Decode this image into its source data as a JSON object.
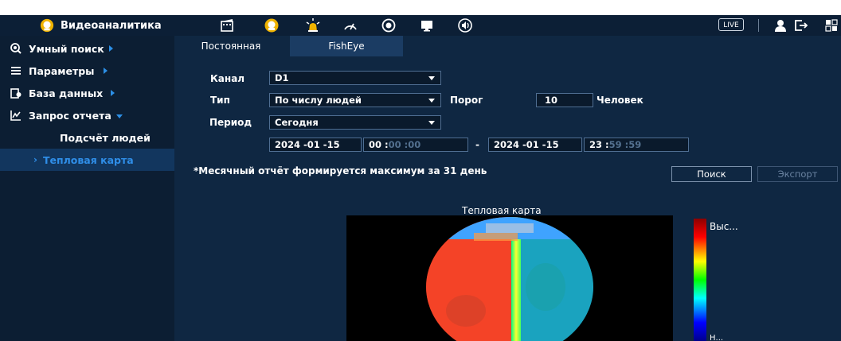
{
  "app": {
    "title": "Видеоаналитика"
  },
  "topbar": {
    "icons": [
      "film-icon",
      "face-icon",
      "alarm-icon",
      "gauge-icon",
      "record-icon",
      "monitor-icon",
      "speaker-icon"
    ],
    "live_label": "LIVE",
    "right_icons": [
      "user-icon",
      "logout-icon",
      "grid-icon"
    ]
  },
  "sidebar": {
    "items": [
      {
        "label": "Умный поиск",
        "icon": "smart-search-icon"
      },
      {
        "label": "Параметры",
        "icon": "list-icon"
      },
      {
        "label": "База данных",
        "icon": "database-icon"
      },
      {
        "label": "Запрос отчета",
        "icon": "report-icon"
      }
    ],
    "subitems": [
      {
        "label": "Подсчёт людей"
      },
      {
        "label": "Тепловая карта",
        "active": true,
        "arrow": "›"
      }
    ]
  },
  "tabs": [
    {
      "label": "Постоянная",
      "active": false
    },
    {
      "label": "FishEye",
      "active": true
    }
  ],
  "form": {
    "channel_label": "Канал",
    "channel_value": "D1",
    "type_label": "Тип",
    "type_value": "По числу людей",
    "threshold_label": "Порог",
    "threshold_value": "10",
    "threshold_unit": "Человек",
    "period_label": "Период",
    "period_value": "Сегодня",
    "start_date": "2024 -01 -15",
    "start_time_h": "00 :",
    "start_time_rest": "00 :00",
    "dash": "-",
    "end_date": "2024 -01 -15",
    "end_time_h": "23 :",
    "end_time_rest": "59 :59"
  },
  "note": "*Месячный отчёт формируется максимум за 31 день",
  "buttons": {
    "search": "Поиск",
    "export": "Экспорт"
  },
  "heatmap": {
    "title": "Тепловая карта",
    "legend_high": "Выс...",
    "legend_low": "Н...",
    "colors": [
      "#8b0000",
      "#ff0000",
      "#ffff00",
      "#00ff00",
      "#00ffff",
      "#0000ff",
      "#00008b"
    ]
  }
}
